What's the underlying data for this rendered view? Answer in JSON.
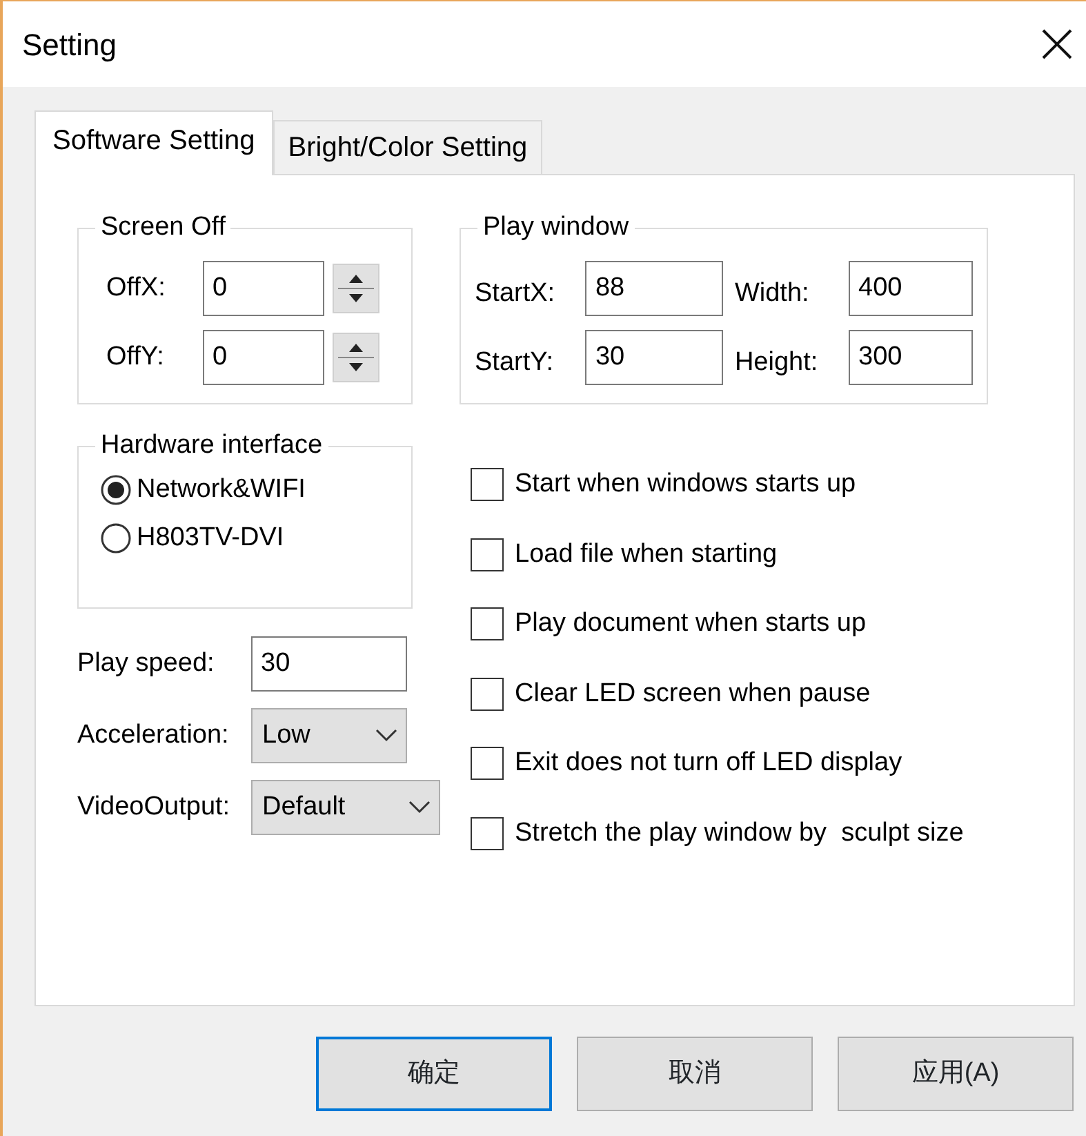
{
  "window": {
    "title": "Setting"
  },
  "tabs": [
    {
      "label": "Software Setting",
      "selected": true
    },
    {
      "label": "Bright/Color Setting",
      "selected": false
    }
  ],
  "screen_off": {
    "title": "Screen Off",
    "fields": [
      {
        "label": "OffX:",
        "value": "0"
      },
      {
        "label": "OffY:",
        "value": "0"
      }
    ]
  },
  "play_window": {
    "title": "Play window",
    "fields": [
      {
        "label": "StartX:",
        "value": "88"
      },
      {
        "label": "Width:",
        "value": "400"
      },
      {
        "label": "StartY:",
        "value": "30"
      },
      {
        "label": "Height:",
        "value": "300"
      }
    ]
  },
  "hardware_interface": {
    "title": "Hardware interface",
    "options": [
      {
        "label": "Network&WIFI",
        "selected": true
      },
      {
        "label": "H803TV-DVI",
        "selected": false
      }
    ]
  },
  "play_speed": {
    "label": "Play speed:",
    "value": "30"
  },
  "acceleration": {
    "label": "Acceleration:",
    "value": "Low"
  },
  "video_output": {
    "label": "VideoOutput:",
    "value": "Default"
  },
  "checkboxes": [
    {
      "label": "Start when windows starts up",
      "checked": false
    },
    {
      "label": "Load file when starting",
      "checked": false
    },
    {
      "label": "Play document when starts up",
      "checked": false
    },
    {
      "label": "Clear LED screen when pause",
      "checked": false
    },
    {
      "label": "Exit does not turn off LED display",
      "checked": false
    },
    {
      "label": "Stretch the play window by  sculpt size",
      "checked": false
    }
  ],
  "buttons": [
    {
      "label": "确定",
      "focused": true
    },
    {
      "label": "取消",
      "focused": false
    },
    {
      "label": "应用(A)",
      "focused": false
    }
  ]
}
